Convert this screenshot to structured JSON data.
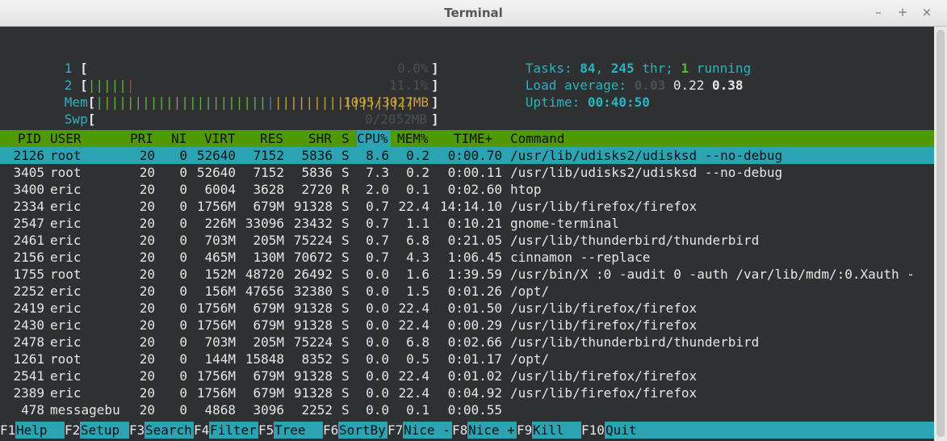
{
  "window": {
    "title": "Terminal",
    "minimize": "–",
    "maximize": "+",
    "close": "×"
  },
  "meters": {
    "cpu1": {
      "label": "1",
      "bar": "",
      "value": "0.0%"
    },
    "cpu2": {
      "label": "2",
      "bar_green": "|||||",
      "bar_red": "|",
      "value": "11.1%"
    },
    "mem": {
      "label": "Mem",
      "bar_green": "||||||||||||||||||||||",
      "bar_blue": "|",
      "bar_yellow": "||||||||||||||||||",
      "value": "1095/3027MB"
    },
    "swp": {
      "label": "Swp",
      "value": "0/2052MB"
    }
  },
  "summary": {
    "tasks_label": "Tasks:",
    "tasks": "84",
    "threads": "245",
    "thr_label": "thr;",
    "running": "1",
    "running_label": "running",
    "load_label": "Load average:",
    "load1": "0.03",
    "load5": "0.22",
    "load15": "0.38",
    "uptime_label": "Uptime:",
    "uptime": "00:40:50"
  },
  "columns": [
    "PID",
    "USER",
    "PRI",
    "NI",
    "VIRT",
    "RES",
    "SHR",
    "S",
    "CPU%",
    "MEM%",
    "TIME+",
    "Command"
  ],
  "processes": [
    {
      "pid": "2126",
      "user": "root",
      "pri": "20",
      "ni": "0",
      "virt": "52640",
      "res": "7152",
      "shr": "5836",
      "s": "S",
      "cpu": "8.6",
      "mem": "0.2",
      "time": "0:00.70",
      "cmd": "/usr/lib/udisks2/udisksd --no-debug"
    },
    {
      "pid": "3405",
      "user": "root",
      "pri": "20",
      "ni": "0",
      "virt": "52640",
      "res": "7152",
      "shr": "5836",
      "s": "S",
      "cpu": "7.3",
      "mem": "0.2",
      "time": "0:00.11",
      "cmd": "/usr/lib/udisks2/udisksd --no-debug"
    },
    {
      "pid": "3400",
      "user": "eric",
      "pri": "20",
      "ni": "0",
      "virt": "6004",
      "res": "3628",
      "shr": "2720",
      "s": "R",
      "cpu": "2.0",
      "mem": "0.1",
      "time": "0:02.60",
      "cmd": "htop"
    },
    {
      "pid": "2334",
      "user": "eric",
      "pri": "20",
      "ni": "0",
      "virt": "1756M",
      "res": "679M",
      "shr": "91328",
      "s": "S",
      "cpu": "0.7",
      "mem": "22.4",
      "time": "14:14.10",
      "cmd": "/usr/lib/firefox/firefox"
    },
    {
      "pid": "2547",
      "user": "eric",
      "pri": "20",
      "ni": "0",
      "virt": "226M",
      "res": "33096",
      "shr": "23432",
      "s": "S",
      "cpu": "0.7",
      "mem": "1.1",
      "time": "0:10.21",
      "cmd": "gnome-terminal"
    },
    {
      "pid": "2461",
      "user": "eric",
      "pri": "20",
      "ni": "0",
      "virt": "703M",
      "res": "205M",
      "shr": "75224",
      "s": "S",
      "cpu": "0.7",
      "mem": "6.8",
      "time": "0:21.05",
      "cmd": "/usr/lib/thunderbird/thunderbird"
    },
    {
      "pid": "2156",
      "user": "eric",
      "pri": "20",
      "ni": "0",
      "virt": "465M",
      "res": "130M",
      "shr": "70672",
      "s": "S",
      "cpu": "0.7",
      "mem": "4.3",
      "time": "1:06.45",
      "cmd": "cinnamon --replace"
    },
    {
      "pid": "1755",
      "user": "root",
      "pri": "20",
      "ni": "0",
      "virt": "152M",
      "res": "48720",
      "shr": "26492",
      "s": "S",
      "cpu": "0.0",
      "mem": "1.6",
      "time": "1:39.59",
      "cmd": "/usr/bin/X :0 -audit 0 -auth /var/lib/mdm/:0.Xauth -"
    },
    {
      "pid": "2252",
      "user": "eric",
      "pri": "20",
      "ni": "0",
      "virt": "156M",
      "res": "47656",
      "shr": "32380",
      "s": "S",
      "cpu": "0.0",
      "mem": "1.5",
      "time": "0:01.26",
      "cmd": "/opt/"
    },
    {
      "pid": "2419",
      "user": "eric",
      "pri": "20",
      "ni": "0",
      "virt": "1756M",
      "res": "679M",
      "shr": "91328",
      "s": "S",
      "cpu": "0.0",
      "mem": "22.4",
      "time": "0:01.50",
      "cmd": "/usr/lib/firefox/firefox"
    },
    {
      "pid": "2430",
      "user": "eric",
      "pri": "20",
      "ni": "0",
      "virt": "1756M",
      "res": "679M",
      "shr": "91328",
      "s": "S",
      "cpu": "0.0",
      "mem": "22.4",
      "time": "0:00.29",
      "cmd": "/usr/lib/firefox/firefox"
    },
    {
      "pid": "2478",
      "user": "eric",
      "pri": "20",
      "ni": "0",
      "virt": "703M",
      "res": "205M",
      "shr": "75224",
      "s": "S",
      "cpu": "0.0",
      "mem": "6.8",
      "time": "0:02.66",
      "cmd": "/usr/lib/thunderbird/thunderbird"
    },
    {
      "pid": "1261",
      "user": "root",
      "pri": "20",
      "ni": "0",
      "virt": "144M",
      "res": "15848",
      "shr": "8352",
      "s": "S",
      "cpu": "0.0",
      "mem": "0.5",
      "time": "0:01.17",
      "cmd": "/opt/"
    },
    {
      "pid": "2541",
      "user": "eric",
      "pri": "20",
      "ni": "0",
      "virt": "1756M",
      "res": "679M",
      "shr": "91328",
      "s": "S",
      "cpu": "0.0",
      "mem": "22.4",
      "time": "0:01.02",
      "cmd": "/usr/lib/firefox/firefox"
    },
    {
      "pid": "2389",
      "user": "eric",
      "pri": "20",
      "ni": "0",
      "virt": "1756M",
      "res": "679M",
      "shr": "91328",
      "s": "S",
      "cpu": "0.0",
      "mem": "22.4",
      "time": "0:04.92",
      "cmd": "/usr/lib/firefox/firefox"
    },
    {
      "pid": "478",
      "user": "messagebu",
      "pri": "20",
      "ni": "0",
      "virt": "4868",
      "res": "3096",
      "shr": "2252",
      "s": "S",
      "cpu": "0.0",
      "mem": "0.1",
      "time": "0:00.55",
      "cmd": ""
    }
  ],
  "footer": [
    {
      "key": "F1",
      "label": "Help"
    },
    {
      "key": "F2",
      "label": "Setup"
    },
    {
      "key": "F3",
      "label": "Search"
    },
    {
      "key": "F4",
      "label": "Filter"
    },
    {
      "key": "F5",
      "label": "Tree"
    },
    {
      "key": "F6",
      "label": "SortBy"
    },
    {
      "key": "F7",
      "label": "Nice -"
    },
    {
      "key": "F8",
      "label": "Nice +"
    },
    {
      "key": "F9",
      "label": "Kill"
    },
    {
      "key": "F10",
      "label": "Quit"
    }
  ],
  "colors": {
    "header_bg": "#4e9a06",
    "selected_bg": "#2ba3b3",
    "cyan": "#2bb3c0",
    "terminal_bg": "#2e3031"
  }
}
